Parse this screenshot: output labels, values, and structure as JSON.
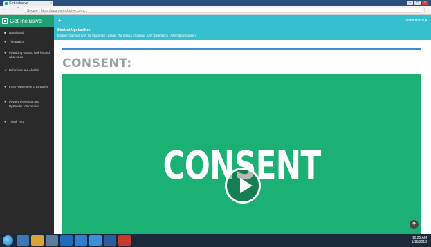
{
  "browser": {
    "tab_title": "GetInclusive",
    "tab_close": "×",
    "nav": [
      "←",
      "→",
      "C"
    ],
    "url": "Secure | https://app.getinclusive.com/...",
    "menu": "⋮",
    "window_controls": [
      "–",
      "□",
      "×"
    ]
  },
  "header": {
    "brand": "Get Inclusive",
    "plus": "+",
    "user": "Dana Harris ▾"
  },
  "sidebar": {
    "items": [
      {
        "label": "Dashboard",
        "icon": "grid-icon"
      },
      {
        "label": "The Basics",
        "icon": "check-icon"
      },
      {
        "label": "Practicing what to look for and what to do",
        "icon": "check-icon"
      },
      {
        "label": "Behaviors and Alcohol",
        "icon": "check-icon"
      },
      {
        "label": "From Awareness to Empathy",
        "icon": "check-icon"
      },
      {
        "label": "Privacy Protection and Bystander Intervention",
        "icon": "check-icon"
      },
      {
        "label": "Thank You",
        "icon": "check-icon"
      }
    ]
  },
  "breadcrumb": {
    "title": "Student Upstanders",
    "path": "Module: Campus SAR for Students  /  Lesson: The Basics  /  Campus SAR: Definitions - Affirmative Consent"
  },
  "content": {
    "heading": "CONSENT:",
    "video_word": "CONSENT",
    "help": "?"
  },
  "taskbar": {
    "tray_time": "10:25 AM",
    "tray_date": "1/18/2018"
  },
  "colors": {
    "accent": "#35bfcf",
    "brand": "#1f9f74",
    "video_bg": "#1bb074",
    "sidebar_bg": "#2a2a2a"
  }
}
